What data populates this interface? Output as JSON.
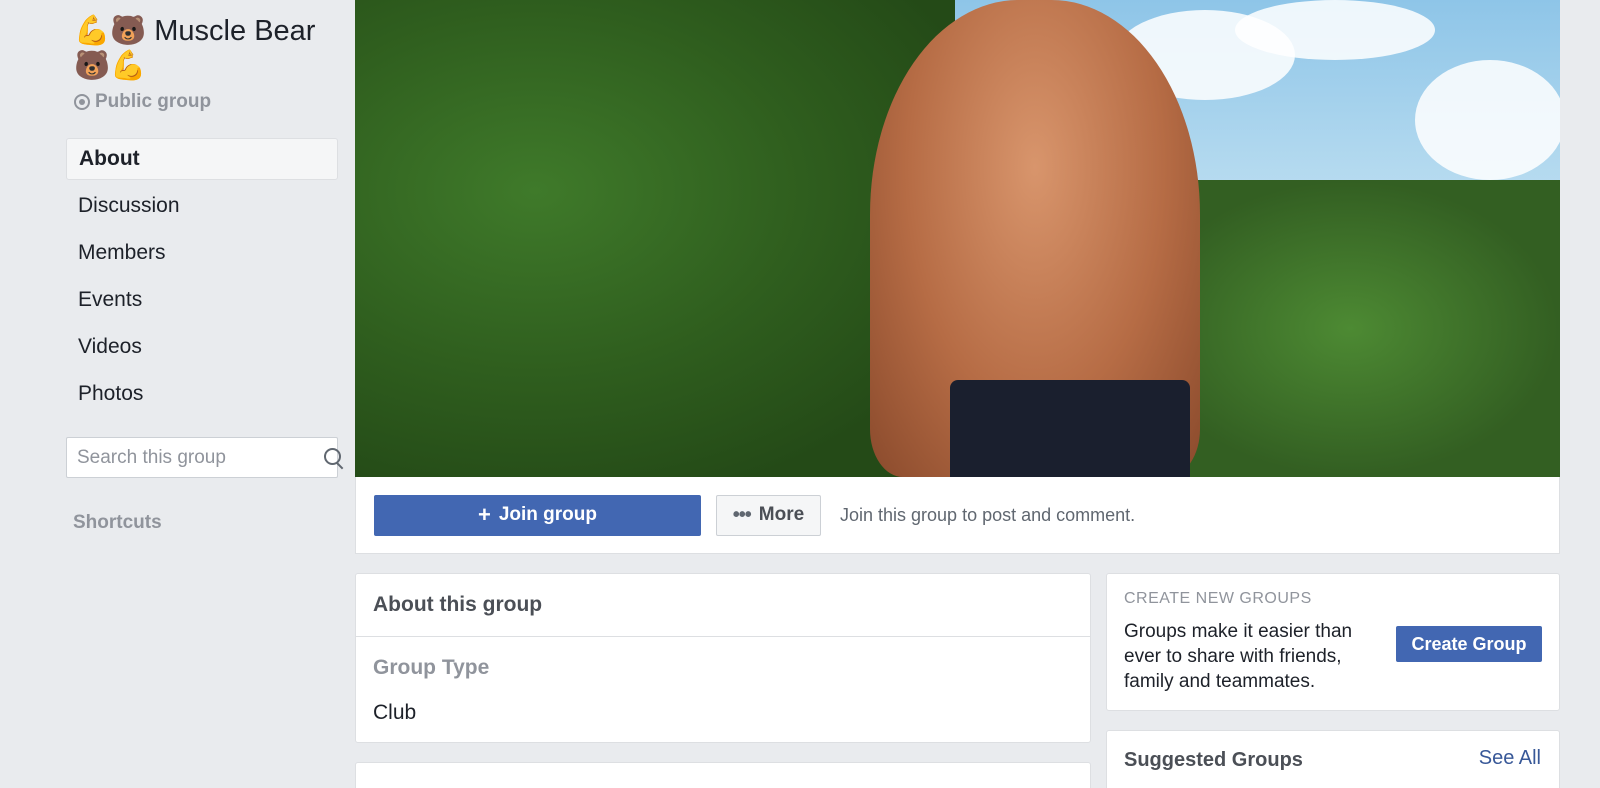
{
  "group": {
    "name": "💪🐻 Muscle Bear 🐻💪",
    "privacy": "Public group"
  },
  "nav": {
    "items": [
      {
        "label": "About",
        "active": true
      },
      {
        "label": "Discussion",
        "active": false
      },
      {
        "label": "Members",
        "active": false
      },
      {
        "label": "Events",
        "active": false
      },
      {
        "label": "Videos",
        "active": false
      },
      {
        "label": "Photos",
        "active": false
      }
    ]
  },
  "search": {
    "placeholder": "Search this group",
    "value": ""
  },
  "shortcuts": {
    "label": "Shortcuts"
  },
  "actions": {
    "join_label": "Join group",
    "more_label": "More",
    "hint": "Join this group to post and comment."
  },
  "about": {
    "title": "About this group",
    "type_label": "Group Type",
    "type_value": "Club"
  },
  "create_groups": {
    "heading": "CREATE NEW GROUPS",
    "description": "Groups make it easier than ever to share with friends, family and teammates.",
    "button_label": "Create Group"
  },
  "suggested": {
    "title": "Suggested Groups",
    "see_all": "See All"
  },
  "colors": {
    "brand_blue": "#4267b2",
    "link_blue": "#385898",
    "background": "#e9ebee"
  }
}
